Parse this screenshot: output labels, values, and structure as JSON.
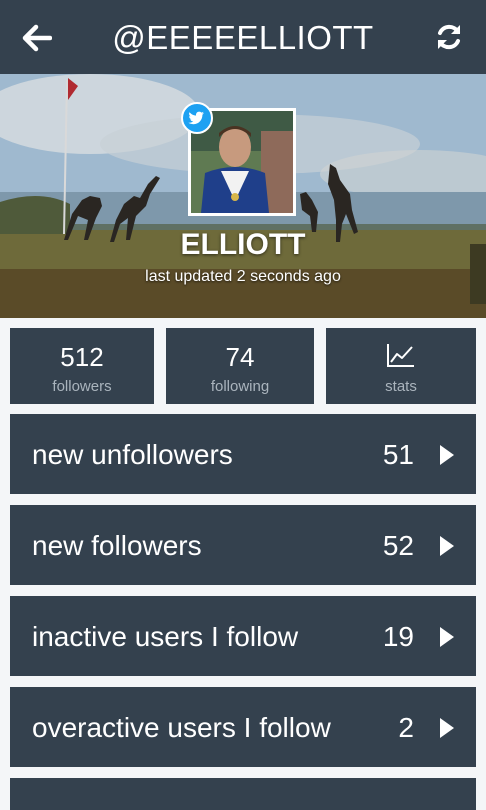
{
  "header": {
    "title": "@EEEEELLIOTT",
    "back_icon": "arrow-left-icon",
    "refresh_icon": "refresh-icon"
  },
  "profile": {
    "name": "ELLIOTT",
    "updated": "last updated 2 seconds ago",
    "badge_icon": "twitter-bird-icon"
  },
  "stats": [
    {
      "value": "512",
      "label": "followers"
    },
    {
      "value": "74",
      "label": "following"
    },
    {
      "value": "",
      "label": "stats",
      "icon": "line-chart-icon"
    }
  ],
  "rows": [
    {
      "label": "new unfollowers",
      "count": "51"
    },
    {
      "label": "new followers",
      "count": "52"
    },
    {
      "label": "inactive users I follow",
      "count": "19"
    },
    {
      "label": "overactive users I follow",
      "count": "2"
    }
  ],
  "colors": {
    "tile": "#34414e",
    "background": "#f4f6f8",
    "twitter": "#1da1f2",
    "muted": "#aab4bd"
  }
}
